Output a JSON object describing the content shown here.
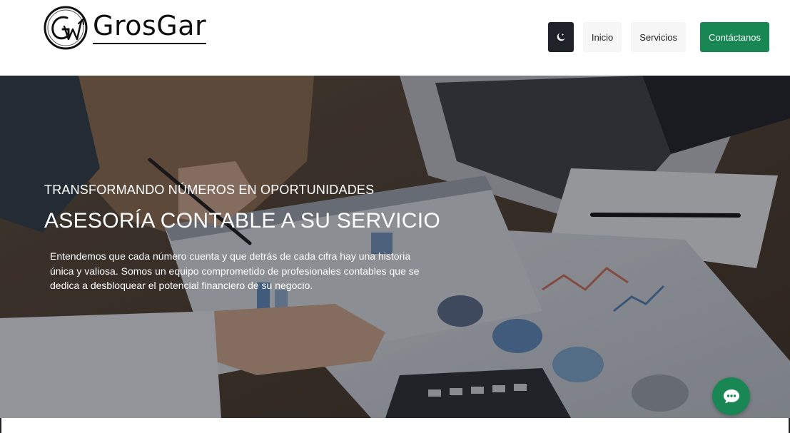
{
  "brand": {
    "name": "GrosGar",
    "logo_icon": "grosgar-monogram-logo",
    "accent_color": "#198754",
    "dark_color": "#1f2329"
  },
  "nav": {
    "theme_toggle_icon": "moon-stars-icon",
    "items": [
      {
        "label": "Inicio"
      },
      {
        "label": "Servicios"
      }
    ],
    "contact_label": "Contáctanos"
  },
  "hero": {
    "background_image": "accounting-documents-charts-laptop-photo",
    "subtitle": "TRANSFORMANDO NÚMEROS EN OPORTUNIDADES",
    "title": "ASESORÍA CONTABLE A SU SERVICIO",
    "description": "Entendemos que cada número cuenta y que detrás de cada cifra hay una historia única y valiosa. Somos un equipo comprometido de profesionales contables que se dedica a desbloquear el potencial financiero de su negocio."
  },
  "chat": {
    "icon": "chat-bubble-icon"
  }
}
